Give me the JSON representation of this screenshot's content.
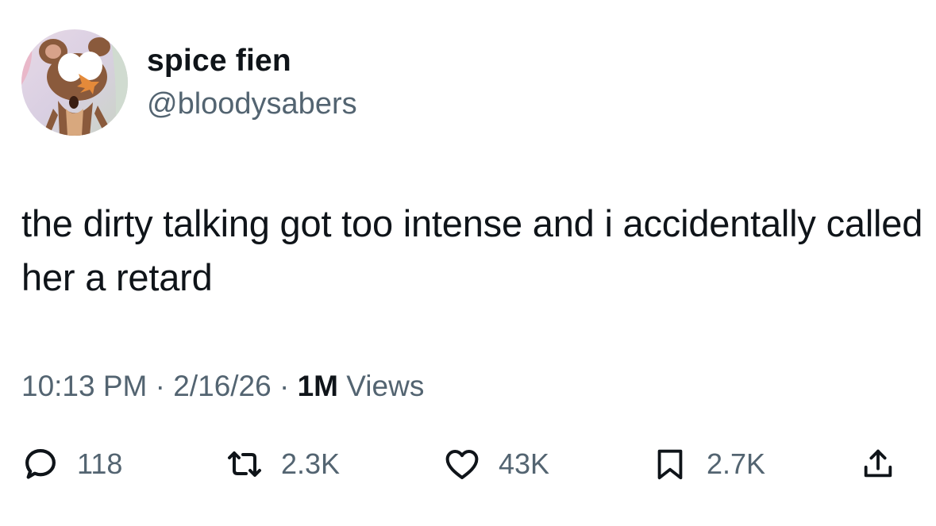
{
  "user": {
    "display_name": "spice fien",
    "handle": "@bloodysabers",
    "avatar_icon": "cartoon-mouse-avatar"
  },
  "tweet": {
    "text": "the dirty talking got too intense and i accidentally called her a retard"
  },
  "meta": {
    "time": "10:13 PM",
    "separator": "·",
    "date": "2/16/26",
    "views_count": "1M",
    "views_label": "Views"
  },
  "actions": {
    "reply": {
      "icon": "reply-icon",
      "count": "118"
    },
    "retweet": {
      "icon": "retweet-icon",
      "count": "2.3K"
    },
    "like": {
      "icon": "heart-icon",
      "count": "43K"
    },
    "bookmark": {
      "icon": "bookmark-icon",
      "count": "2.7K"
    },
    "share": {
      "icon": "share-icon"
    }
  },
  "colors": {
    "text_primary": "#0f1419",
    "text_secondary": "#536471",
    "background": "#ffffff"
  }
}
